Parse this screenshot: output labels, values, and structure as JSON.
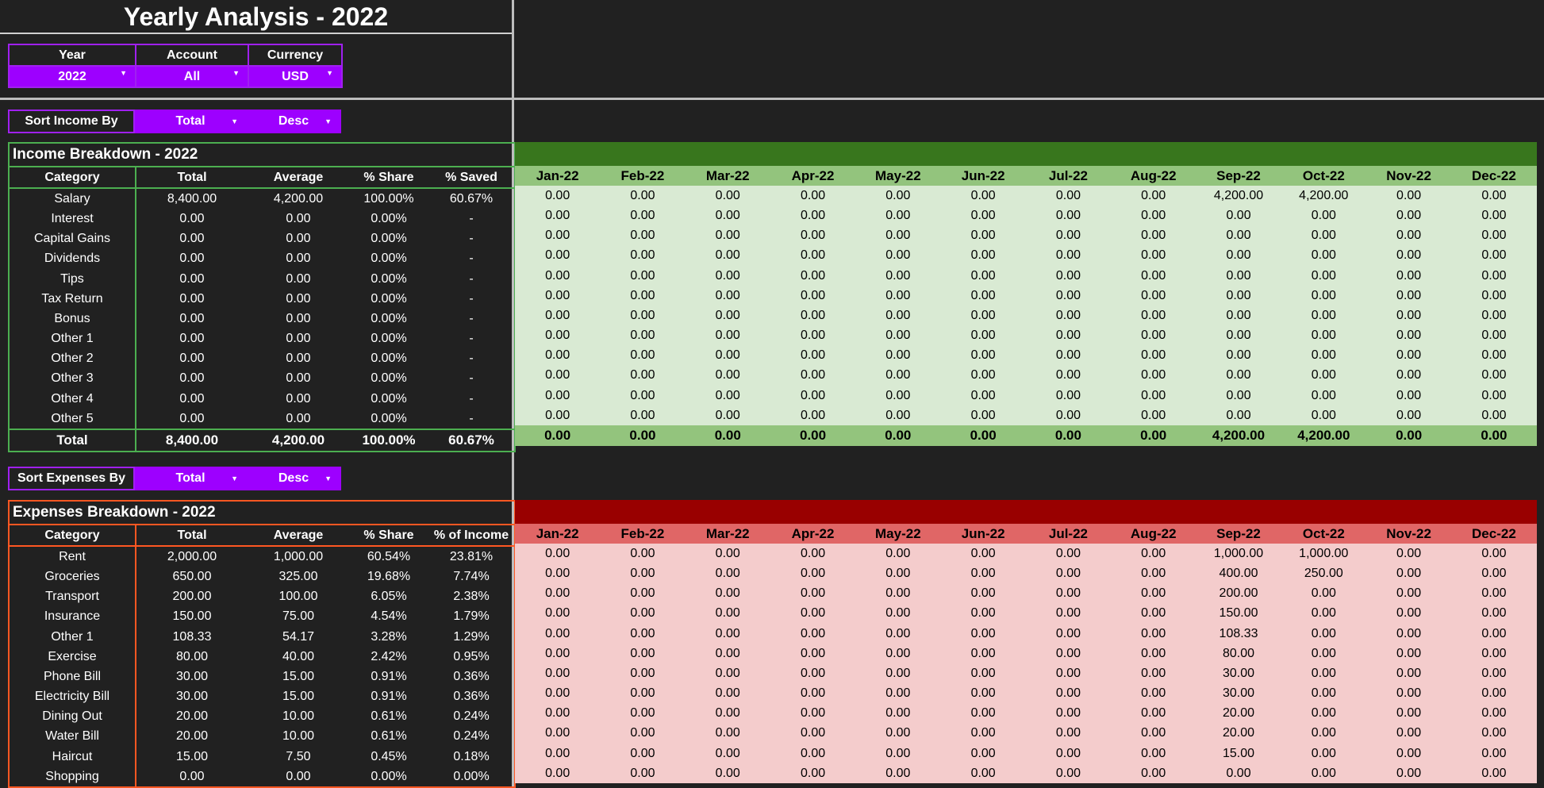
{
  "title": "Yearly Analysis - 2022",
  "filters": {
    "headers": [
      "Year",
      "Account",
      "Currency"
    ],
    "values": [
      "2022",
      "All",
      "USD"
    ]
  },
  "income_sort": {
    "label": "Sort Income By",
    "by": "Total",
    "order": "Desc"
  },
  "expense_sort": {
    "label": "Sort Expenses By",
    "by": "Total",
    "order": "Desc"
  },
  "months": [
    "Jan-22",
    "Feb-22",
    "Mar-22",
    "Apr-22",
    "May-22",
    "Jun-22",
    "Jul-22",
    "Aug-22",
    "Sep-22",
    "Oct-22",
    "Nov-22",
    "Dec-22"
  ],
  "income": {
    "title": "Income Breakdown - 2022",
    "headers": [
      "Category",
      "Total",
      "Average",
      "% Share",
      "% Saved"
    ],
    "rows": [
      {
        "cells": [
          "Salary",
          "8,400.00",
          "4,200.00",
          "100.00%",
          "60.67%"
        ],
        "months": [
          "0.00",
          "0.00",
          "0.00",
          "0.00",
          "0.00",
          "0.00",
          "0.00",
          "0.00",
          "4,200.00",
          "4,200.00",
          "0.00",
          "0.00"
        ]
      },
      {
        "cells": [
          "Interest",
          "0.00",
          "0.00",
          "0.00%",
          "-"
        ],
        "months": [
          "0.00",
          "0.00",
          "0.00",
          "0.00",
          "0.00",
          "0.00",
          "0.00",
          "0.00",
          "0.00",
          "0.00",
          "0.00",
          "0.00"
        ]
      },
      {
        "cells": [
          "Capital Gains",
          "0.00",
          "0.00",
          "0.00%",
          "-"
        ],
        "months": [
          "0.00",
          "0.00",
          "0.00",
          "0.00",
          "0.00",
          "0.00",
          "0.00",
          "0.00",
          "0.00",
          "0.00",
          "0.00",
          "0.00"
        ]
      },
      {
        "cells": [
          "Dividends",
          "0.00",
          "0.00",
          "0.00%",
          "-"
        ],
        "months": [
          "0.00",
          "0.00",
          "0.00",
          "0.00",
          "0.00",
          "0.00",
          "0.00",
          "0.00",
          "0.00",
          "0.00",
          "0.00",
          "0.00"
        ]
      },
      {
        "cells": [
          "Tips",
          "0.00",
          "0.00",
          "0.00%",
          "-"
        ],
        "months": [
          "0.00",
          "0.00",
          "0.00",
          "0.00",
          "0.00",
          "0.00",
          "0.00",
          "0.00",
          "0.00",
          "0.00",
          "0.00",
          "0.00"
        ]
      },
      {
        "cells": [
          "Tax Return",
          "0.00",
          "0.00",
          "0.00%",
          "-"
        ],
        "months": [
          "0.00",
          "0.00",
          "0.00",
          "0.00",
          "0.00",
          "0.00",
          "0.00",
          "0.00",
          "0.00",
          "0.00",
          "0.00",
          "0.00"
        ]
      },
      {
        "cells": [
          "Bonus",
          "0.00",
          "0.00",
          "0.00%",
          "-"
        ],
        "months": [
          "0.00",
          "0.00",
          "0.00",
          "0.00",
          "0.00",
          "0.00",
          "0.00",
          "0.00",
          "0.00",
          "0.00",
          "0.00",
          "0.00"
        ]
      },
      {
        "cells": [
          "Other 1",
          "0.00",
          "0.00",
          "0.00%",
          "-"
        ],
        "months": [
          "0.00",
          "0.00",
          "0.00",
          "0.00",
          "0.00",
          "0.00",
          "0.00",
          "0.00",
          "0.00",
          "0.00",
          "0.00",
          "0.00"
        ]
      },
      {
        "cells": [
          "Other 2",
          "0.00",
          "0.00",
          "0.00%",
          "-"
        ],
        "months": [
          "0.00",
          "0.00",
          "0.00",
          "0.00",
          "0.00",
          "0.00",
          "0.00",
          "0.00",
          "0.00",
          "0.00",
          "0.00",
          "0.00"
        ]
      },
      {
        "cells": [
          "Other 3",
          "0.00",
          "0.00",
          "0.00%",
          "-"
        ],
        "months": [
          "0.00",
          "0.00",
          "0.00",
          "0.00",
          "0.00",
          "0.00",
          "0.00",
          "0.00",
          "0.00",
          "0.00",
          "0.00",
          "0.00"
        ]
      },
      {
        "cells": [
          "Other 4",
          "0.00",
          "0.00",
          "0.00%",
          "-"
        ],
        "months": [
          "0.00",
          "0.00",
          "0.00",
          "0.00",
          "0.00",
          "0.00",
          "0.00",
          "0.00",
          "0.00",
          "0.00",
          "0.00",
          "0.00"
        ]
      },
      {
        "cells": [
          "Other 5",
          "0.00",
          "0.00",
          "0.00%",
          "-"
        ],
        "months": [
          "0.00",
          "0.00",
          "0.00",
          "0.00",
          "0.00",
          "0.00",
          "0.00",
          "0.00",
          "0.00",
          "0.00",
          "0.00",
          "0.00"
        ]
      }
    ],
    "total": {
      "cells": [
        "Total",
        "8,400.00",
        "4,200.00",
        "100.00%",
        "60.67%"
      ],
      "months": [
        "0.00",
        "0.00",
        "0.00",
        "0.00",
        "0.00",
        "0.00",
        "0.00",
        "0.00",
        "4,200.00",
        "4,200.00",
        "0.00",
        "0.00"
      ]
    }
  },
  "expenses": {
    "title": "Expenses Breakdown - 2022",
    "headers": [
      "Category",
      "Total",
      "Average",
      "% Share",
      "% of Income"
    ],
    "rows": [
      {
        "cells": [
          "Rent",
          "2,000.00",
          "1,000.00",
          "60.54%",
          "23.81%"
        ],
        "months": [
          "0.00",
          "0.00",
          "0.00",
          "0.00",
          "0.00",
          "0.00",
          "0.00",
          "0.00",
          "1,000.00",
          "1,000.00",
          "0.00",
          "0.00"
        ]
      },
      {
        "cells": [
          "Groceries",
          "650.00",
          "325.00",
          "19.68%",
          "7.74%"
        ],
        "months": [
          "0.00",
          "0.00",
          "0.00",
          "0.00",
          "0.00",
          "0.00",
          "0.00",
          "0.00",
          "400.00",
          "250.00",
          "0.00",
          "0.00"
        ]
      },
      {
        "cells": [
          "Transport",
          "200.00",
          "100.00",
          "6.05%",
          "2.38%"
        ],
        "months": [
          "0.00",
          "0.00",
          "0.00",
          "0.00",
          "0.00",
          "0.00",
          "0.00",
          "0.00",
          "200.00",
          "0.00",
          "0.00",
          "0.00"
        ]
      },
      {
        "cells": [
          "Insurance",
          "150.00",
          "75.00",
          "4.54%",
          "1.79%"
        ],
        "months": [
          "0.00",
          "0.00",
          "0.00",
          "0.00",
          "0.00",
          "0.00",
          "0.00",
          "0.00",
          "150.00",
          "0.00",
          "0.00",
          "0.00"
        ]
      },
      {
        "cells": [
          "Other 1",
          "108.33",
          "54.17",
          "3.28%",
          "1.29%"
        ],
        "months": [
          "0.00",
          "0.00",
          "0.00",
          "0.00",
          "0.00",
          "0.00",
          "0.00",
          "0.00",
          "108.33",
          "0.00",
          "0.00",
          "0.00"
        ]
      },
      {
        "cells": [
          "Exercise",
          "80.00",
          "40.00",
          "2.42%",
          "0.95%"
        ],
        "months": [
          "0.00",
          "0.00",
          "0.00",
          "0.00",
          "0.00",
          "0.00",
          "0.00",
          "0.00",
          "80.00",
          "0.00",
          "0.00",
          "0.00"
        ]
      },
      {
        "cells": [
          "Phone Bill",
          "30.00",
          "15.00",
          "0.91%",
          "0.36%"
        ],
        "months": [
          "0.00",
          "0.00",
          "0.00",
          "0.00",
          "0.00",
          "0.00",
          "0.00",
          "0.00",
          "30.00",
          "0.00",
          "0.00",
          "0.00"
        ]
      },
      {
        "cells": [
          "Electricity Bill",
          "30.00",
          "15.00",
          "0.91%",
          "0.36%"
        ],
        "months": [
          "0.00",
          "0.00",
          "0.00",
          "0.00",
          "0.00",
          "0.00",
          "0.00",
          "0.00",
          "30.00",
          "0.00",
          "0.00",
          "0.00"
        ]
      },
      {
        "cells": [
          "Dining Out",
          "20.00",
          "10.00",
          "0.61%",
          "0.24%"
        ],
        "months": [
          "0.00",
          "0.00",
          "0.00",
          "0.00",
          "0.00",
          "0.00",
          "0.00",
          "0.00",
          "20.00",
          "0.00",
          "0.00",
          "0.00"
        ]
      },
      {
        "cells": [
          "Water Bill",
          "20.00",
          "10.00",
          "0.61%",
          "0.24%"
        ],
        "months": [
          "0.00",
          "0.00",
          "0.00",
          "0.00",
          "0.00",
          "0.00",
          "0.00",
          "0.00",
          "20.00",
          "0.00",
          "0.00",
          "0.00"
        ]
      },
      {
        "cells": [
          "Haircut",
          "15.00",
          "7.50",
          "0.45%",
          "0.18%"
        ],
        "months": [
          "0.00",
          "0.00",
          "0.00",
          "0.00",
          "0.00",
          "0.00",
          "0.00",
          "0.00",
          "15.00",
          "0.00",
          "0.00",
          "0.00"
        ]
      },
      {
        "cells": [
          "Shopping",
          "0.00",
          "0.00",
          "0.00%",
          "0.00%"
        ],
        "months": [
          "0.00",
          "0.00",
          "0.00",
          "0.00",
          "0.00",
          "0.00",
          "0.00",
          "0.00",
          "0.00",
          "0.00",
          "0.00",
          "0.00"
        ]
      }
    ]
  },
  "colors": {
    "background": "#212121",
    "accent_purple": "#9d00ff",
    "income_border": "#4caf50",
    "income_band": "#38761d",
    "income_header": "#93c47d",
    "income_cell": "#d9ead3",
    "expense_border": "#ff5722",
    "expense_band": "#990000",
    "expense_header": "#e06666",
    "expense_cell": "#f4cccc"
  }
}
